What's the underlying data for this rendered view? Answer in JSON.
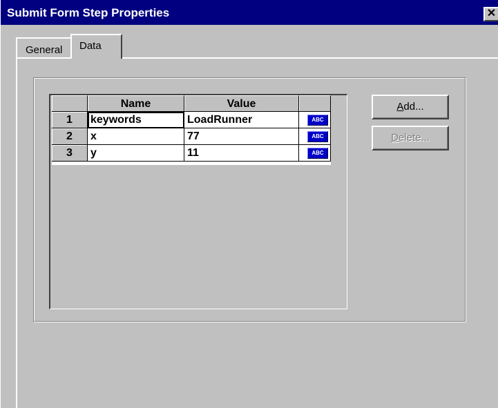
{
  "window": {
    "title": "Submit Form Step Properties",
    "close_glyph": "✕"
  },
  "tabs": [
    {
      "label": "General",
      "active": false
    },
    {
      "label": "Data",
      "active": true
    }
  ],
  "grid": {
    "columns": [
      "",
      "Name",
      "Value",
      ""
    ],
    "rows": [
      {
        "num": "1",
        "name": "keywords",
        "value": "LoadRunner",
        "type_badge": "ABC"
      },
      {
        "num": "2",
        "name": "x",
        "value": "77",
        "type_badge": "ABC"
      },
      {
        "num": "3",
        "name": "y",
        "value": "11",
        "type_badge": "ABC"
      }
    ]
  },
  "buttons": {
    "add": {
      "mnemonic": "A",
      "rest": "dd..."
    },
    "delete": {
      "mnemonic": "D",
      "rest": "elete..."
    }
  },
  "colors": {
    "titlebar": "#000080",
    "badge": "#0000c8",
    "face": "#c0c0c0"
  }
}
